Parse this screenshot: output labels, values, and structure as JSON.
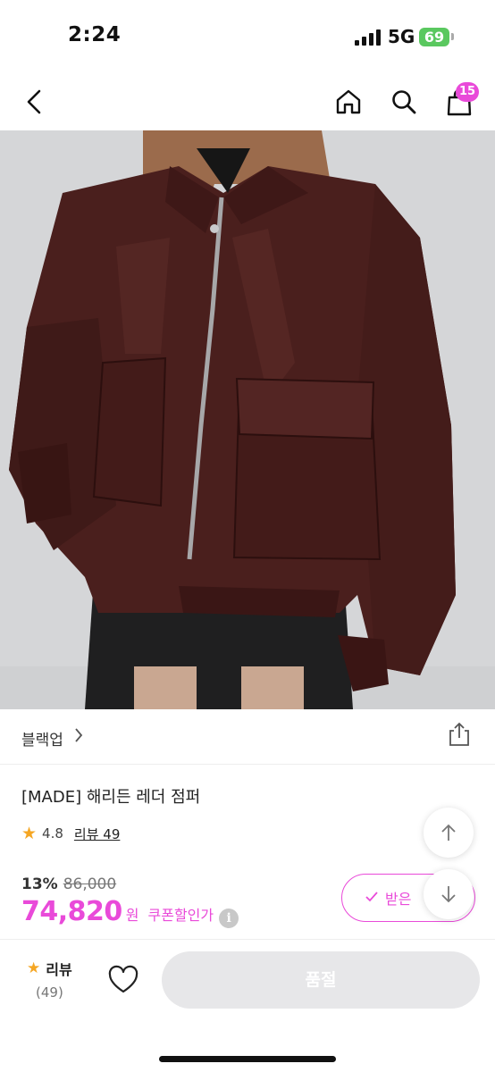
{
  "status": {
    "time": "2:24",
    "network": "5G",
    "battery": "69"
  },
  "header": {
    "back_icon": "chevron-left-icon",
    "home_icon": "home-icon",
    "search_icon": "search-icon",
    "cart_icon": "bag-icon",
    "cart_count": "15"
  },
  "product": {
    "brand": "블랙업",
    "title": "[MADE] 해리든 레더 점퍼",
    "rating": "4.8",
    "review_link": "리뷰 49",
    "discount_rate": "13%",
    "original_price": "86,000",
    "price": "74,820",
    "currency": "원",
    "coupon_text": "쿠폰할인가",
    "coupon_button": "받은 ",
    "info_icon": "i"
  },
  "bottom_bar": {
    "review_label": "리뷰",
    "review_count": "(49)",
    "soldout_label": "품절"
  },
  "colors": {
    "accent": "#e94ad9",
    "jacket": "#4a1f1d",
    "background": "#d5d6d8"
  }
}
